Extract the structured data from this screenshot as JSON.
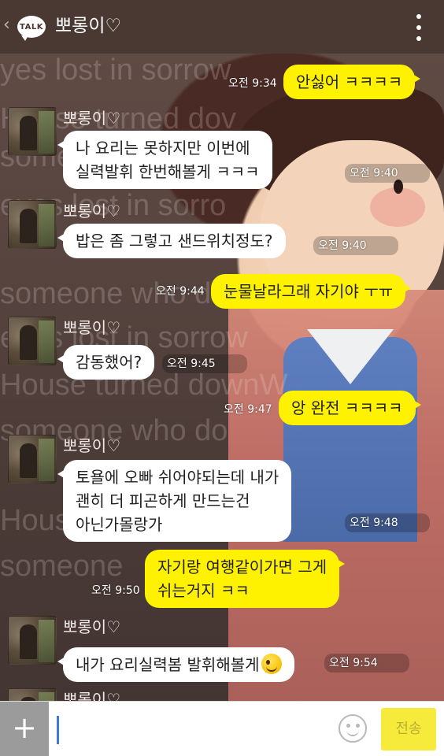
{
  "header": {
    "logo_text": "TALK",
    "title": "뽀롱이♡",
    "back_icon": "chevron-left-icon",
    "menu_icon": "more-vertical-icon"
  },
  "background_text": [
    "yes lost in sorrow",
    "House turned dov",
    "someone who do",
    "eyes lost in sorro",
    "someone who do",
    "eyes lost in sorrow",
    "House turned downW",
    "someone who do",
    "House",
    "someone"
  ],
  "messages": [
    {
      "side": "out",
      "text": "안싫어 ㅋㅋㅋㅋ",
      "time": "오전 9:34"
    },
    {
      "side": "in",
      "sender": "뽀롱이♡",
      "lines": [
        "나 요리는 못하지만 이번에",
        "실력발휘 한번해볼게 ㅋㅋㅋ"
      ],
      "time": "오전 9:40"
    },
    {
      "side": "in",
      "sender": "뽀롱이♡",
      "text": "밥은 좀 그렇고 샌드위치정도?",
      "time": "오전 9:40"
    },
    {
      "side": "out",
      "text": "눈물날라그래 자기야 ㅜㅠ",
      "time": "오전 9:44"
    },
    {
      "side": "in",
      "sender": "뽀롱이♡",
      "text": "감동했어?",
      "time": "오전 9:45"
    },
    {
      "side": "out",
      "text": "앙 완전 ㅋㅋㅋㅋ",
      "time": "오전 9:47"
    },
    {
      "side": "in",
      "sender": "뽀롱이♡",
      "lines": [
        "토욜에 오빠 쉬어야되는데 내가",
        "괜히 더 피곤하게 만드는건",
        "아닌가몰랑가"
      ],
      "time": "오전 9:48"
    },
    {
      "side": "out",
      "lines": [
        "자기랑 여행같이가면 그게",
        "쉬는거지 ㅋㅋ"
      ],
      "time": "오전 9:50"
    },
    {
      "side": "in",
      "sender": "뽀롱이♡",
      "text": "내가 요리실력봄 발휘해볼게",
      "emoji": "wink-emoji-icon",
      "time": "오전 9:54"
    },
    {
      "side": "in",
      "sender": "뽀롱이♡"
    }
  ],
  "input_bar": {
    "plus_label": "+",
    "input_placeholder": "",
    "emoticon_icon": "smiley-icon",
    "send_label": "전송"
  },
  "colors": {
    "header_bg": "#4a3832",
    "outgoing_bubble": "#fff200",
    "incoming_bubble": "#ffffff",
    "send_button": "#f6ea3b"
  }
}
